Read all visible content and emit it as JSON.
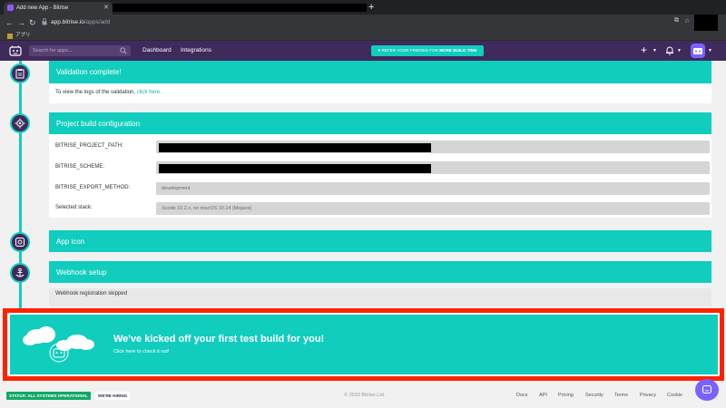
{
  "browser": {
    "tab_title": "Add new App - Bitrise",
    "url_domain": "app.bitrise.io",
    "url_path": "/apps/add",
    "bookmark_label": "アプリ"
  },
  "appnav": {
    "search_placeholder": "Search for apps...",
    "links": [
      "Dashboard",
      "Integrations"
    ],
    "refer_prefix": "REFER YOUR FRIENDS FOR",
    "refer_bold": "MORE BUILD TIME"
  },
  "steps": {
    "validation": {
      "title": "Validation complete!",
      "text_prefix": "To view the logs of the validation,",
      "link": "click here."
    },
    "config": {
      "title": "Project build configuration",
      "rows": [
        {
          "label": "BITRISE_PROJECT_PATH:",
          "value": ""
        },
        {
          "label": "BITRISE_SCHEME:",
          "value": ""
        },
        {
          "label": "BITRISE_EXPORT_METHOD:",
          "value": "development"
        },
        {
          "label": "Selected stack:",
          "value": "Xcode 10.2.x, on macOS 10.14 (Mojave)"
        }
      ]
    },
    "app_icon": {
      "title": "App icon"
    },
    "webhook": {
      "title": "Webhook setup",
      "text": "Webhook registration skipped"
    }
  },
  "banner": {
    "title": "We've kicked off your first test build for you!",
    "link": "Click here to check it out!"
  },
  "footer": {
    "status": "STATUS: ALL SYSTEMS OPERATIONAL",
    "hiring": "WE'RE HIRING",
    "copyright": "© 2019 Bitrise Ltd.",
    "links": [
      "Docs",
      "API",
      "Pricing",
      "Security",
      "Terms",
      "Privacy",
      "Cookie"
    ]
  },
  "colors": {
    "accent": "#11cdbe",
    "nav_purple": "#3f2a5c",
    "highlight_red": "#ff2200",
    "status_green": "#11a866"
  },
  "icons": [
    "back-arrow-icon",
    "forward-arrow-icon",
    "reload-icon",
    "lock-icon",
    "bitrise-logo-icon",
    "search-icon",
    "plus-icon",
    "bell-icon",
    "avatar-icon",
    "clipboard-icon",
    "gear-icon",
    "app-icon-grid-icon",
    "anchor-icon",
    "chat-icon"
  ]
}
